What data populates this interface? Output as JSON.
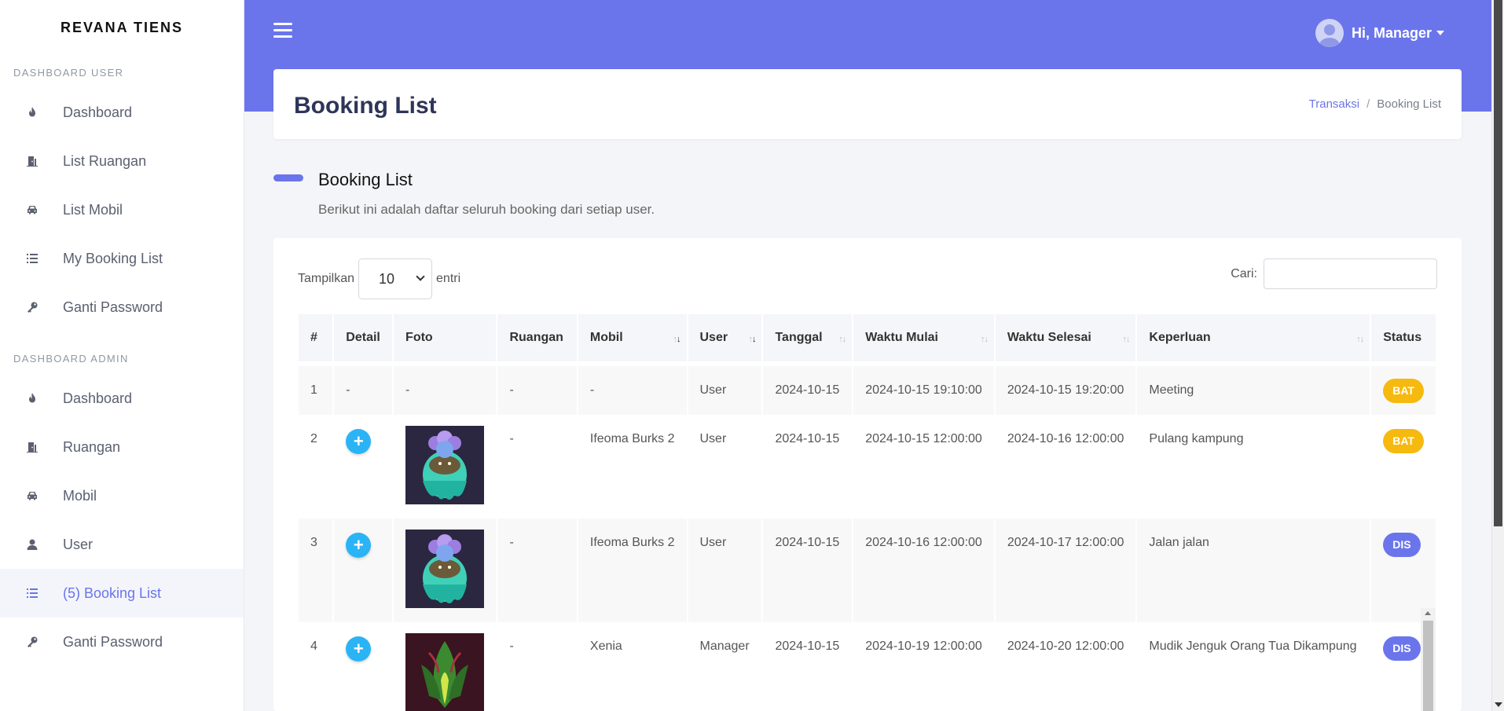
{
  "brand": "REVANA TIENS",
  "sidebar": {
    "user_section": "DASHBOARD USER",
    "user_items": [
      {
        "label": "Dashboard",
        "icon": "fire-icon"
      },
      {
        "label": "List Ruangan",
        "icon": "door-icon"
      },
      {
        "label": "List Mobil",
        "icon": "car-icon"
      },
      {
        "label": "My Booking List",
        "icon": "list-icon"
      },
      {
        "label": "Ganti Password",
        "icon": "key-icon"
      }
    ],
    "admin_section": "DASHBOARD ADMIN",
    "admin_items": [
      {
        "label": "Dashboard",
        "icon": "fire-icon"
      },
      {
        "label": "Ruangan",
        "icon": "door-icon"
      },
      {
        "label": "Mobil",
        "icon": "car-icon"
      },
      {
        "label": "User",
        "icon": "user-icon"
      },
      {
        "label": "(5) Booking List",
        "icon": "list-icon",
        "active": true
      },
      {
        "label": "Ganti Password",
        "icon": "key-icon"
      }
    ]
  },
  "header": {
    "user_greeting": "Hi, Manager"
  },
  "page": {
    "title": "Booking List",
    "breadcrumb": [
      "Transaksi",
      "Booking List"
    ]
  },
  "section": {
    "title": "Booking List",
    "subtitle": "Berikut ini adalah daftar seluruh booking dari setiap user."
  },
  "table_controls": {
    "length_prefix": "Tampilkan",
    "length_value": "10",
    "length_suffix": "entri",
    "search_label": "Cari:",
    "search_value": ""
  },
  "table": {
    "columns": [
      "#",
      "Detail",
      "Foto",
      "Ruangan",
      "Mobil",
      "User",
      "Tanggal",
      "Waktu Mulai",
      "Waktu Selesai",
      "Keperluan",
      "Status"
    ],
    "rows": [
      {
        "no": "1",
        "detail": "-",
        "foto": "-",
        "ruangan": "-",
        "mobil": "-",
        "user": "User",
        "tanggal": "2024-10-15",
        "mulai": "2024-10-15 19:10:00",
        "selesai": "2024-10-15 19:20:00",
        "keperluan": "Meeting",
        "status": "BAT"
      },
      {
        "no": "2",
        "detail": "+",
        "ruangan": "-",
        "mobil": "Ifeoma Burks 2",
        "user": "User",
        "tanggal": "2024-10-15",
        "mulai": "2024-10-15 12:00:00",
        "selesai": "2024-10-16 12:00:00",
        "keperluan": "Pulang kampung",
        "status": "BAT"
      },
      {
        "no": "3",
        "detail": "+",
        "ruangan": "-",
        "mobil": "Ifeoma Burks 2",
        "user": "User",
        "tanggal": "2024-10-15",
        "mulai": "2024-10-16 12:00:00",
        "selesai": "2024-10-17 12:00:00",
        "keperluan": "Jalan jalan",
        "status": "DIS"
      },
      {
        "no": "4",
        "detail": "+",
        "ruangan": "-",
        "mobil": "Xenia",
        "user": "Manager",
        "tanggal": "2024-10-15",
        "mulai": "2024-10-19 12:00:00",
        "selesai": "2024-10-20 12:00:00",
        "keperluan": "Mudik Jenguk Orang Tua Dikampung",
        "status": "DIS"
      }
    ]
  },
  "colors": {
    "primary": "#6a75ec",
    "warning": "#f6b90f",
    "info_button": "#2bb4f5"
  }
}
